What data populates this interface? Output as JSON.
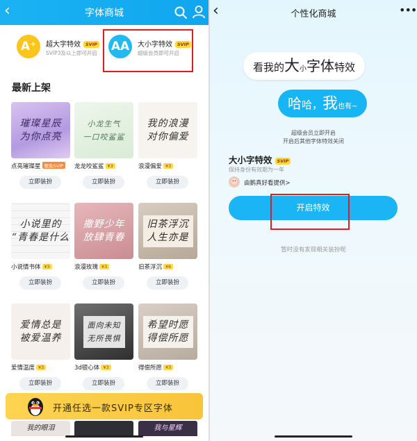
{
  "left": {
    "header": {
      "back": "‹",
      "title": "字体商城"
    },
    "features": [
      {
        "name": "超大字特效",
        "badge": "SVIP",
        "desc": "SVIP3及以上即可开启",
        "icon_text": "A⁺"
      },
      {
        "name": "大小字特效",
        "badge": "SVIP",
        "desc": "超级会员即可开启",
        "icon_text": "AA"
      }
    ],
    "section_title": "最新上架",
    "fonts": [
      {
        "name": "点亮璀璨星",
        "tag": "限免SVIP",
        "art": "璀璨星辰\n为你点亮",
        "button": "立即装扮"
      },
      {
        "name": "龙龙咬鲨鲨",
        "tag": "¥3",
        "art": "小龙生气\n一口咬鲨鲨",
        "button": "立即装扮"
      },
      {
        "name": "浪漫偏爱",
        "tag": "¥3",
        "art": "我的浪漫\n对你偏爱",
        "button": "立即装扮"
      },
      {
        "name": "小说情书体",
        "tag": "¥3",
        "art": "小说里的\n“青春是什么",
        "button": "立即装扮"
      },
      {
        "name": "浪漫玫瑰",
        "tag": "¥3",
        "art": "撒野少年\n放肆青春",
        "button": "立即装扮"
      },
      {
        "name": "旧茶浮沉",
        "tag": "¥6",
        "art": "旧茶浮沉\n人生亦是",
        "button": "立即装扮"
      },
      {
        "name": "爱情温度",
        "tag": "¥3",
        "art": "爱情总是\n被爱温养",
        "button": "立即装扮"
      },
      {
        "name": "3d银心体",
        "tag": "¥3",
        "art": "面向未知\n无所畏惧",
        "button": "立即装扮"
      },
      {
        "name": "得偿所愿",
        "tag": "¥3",
        "art": "希望时愿\n得偿所愿",
        "button": "立即装扮"
      }
    ],
    "peek": [
      "我的眼泪",
      "",
      "我与星辉"
    ],
    "banner": "开通任选一款SVIP专区字体"
  },
  "right": {
    "header": {
      "back": "‹",
      "title": "个性化商城",
      "more": "•••"
    },
    "bubble1": [
      "看我的",
      "大",
      "小",
      "字体",
      "特效"
    ],
    "bubble2": [
      "哈",
      "哈，",
      "我",
      "也有~"
    ],
    "info1": "超级会员立即开启",
    "info2": "开启后其他字体特效关闭",
    "feature_title": "大小字特效",
    "feature_badge": "SVIP",
    "feature_sub": "保持身份有效期为一年",
    "provider": "由鹅真好看提供>",
    "open_button": "开启特效",
    "empty_text": "暂时没有发现相关装扮呢"
  },
  "colors": {
    "primary_blue": "#10a6ef",
    "svip_yellow": "#ffd83a",
    "highlight_red": "#e51a1a",
    "banner_yellow": "#fdd451"
  }
}
